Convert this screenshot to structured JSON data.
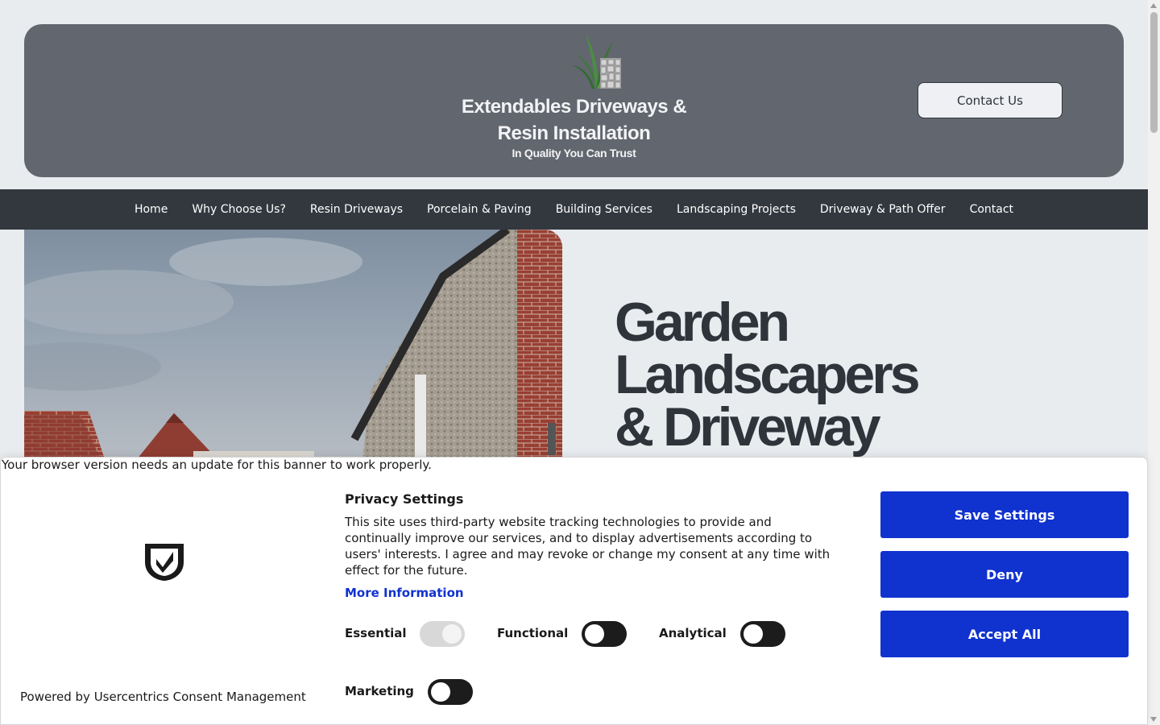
{
  "header": {
    "title_line1": "Extendables Driveways &",
    "title_line2": "Resin Installation",
    "tagline": "In Quality You Can Trust",
    "contact_button": "Contact Us",
    "logo_icon": "grass-paving-logo"
  },
  "nav": {
    "items": [
      "Home",
      "Why Choose Us?",
      "Resin Driveways",
      "Porcelain & Paving",
      "Building Services",
      "Landscaping Projects",
      "Driveway & Path Offer",
      "Contact"
    ]
  },
  "hero": {
    "heading_line1": "Garden",
    "heading_line2": "Landscapers",
    "heading_line3": "& Driveway"
  },
  "consent": {
    "update_notice": "Your browser version needs an update for this banner to work properly.",
    "powered_by": "Powered by Usercentrics Consent Management",
    "title": "Privacy Settings",
    "description": "This site uses third-party website tracking technologies to provide and continually improve our services, and to display advertisements according to users' interests. I agree and may revoke or change my consent at any time with effect for the future.",
    "more_info": "More Information",
    "toggles": {
      "essential": "Essential",
      "functional": "Functional",
      "analytical": "Analytical",
      "marketing": "Marketing"
    },
    "buttons": {
      "save": "Save Settings",
      "deny": "Deny",
      "accept": "Accept All"
    }
  },
  "colors": {
    "header_bg": "#62666e",
    "nav_bg": "#33383f",
    "accent_blue": "#1032cf",
    "page_bg": "#e8ecef"
  }
}
